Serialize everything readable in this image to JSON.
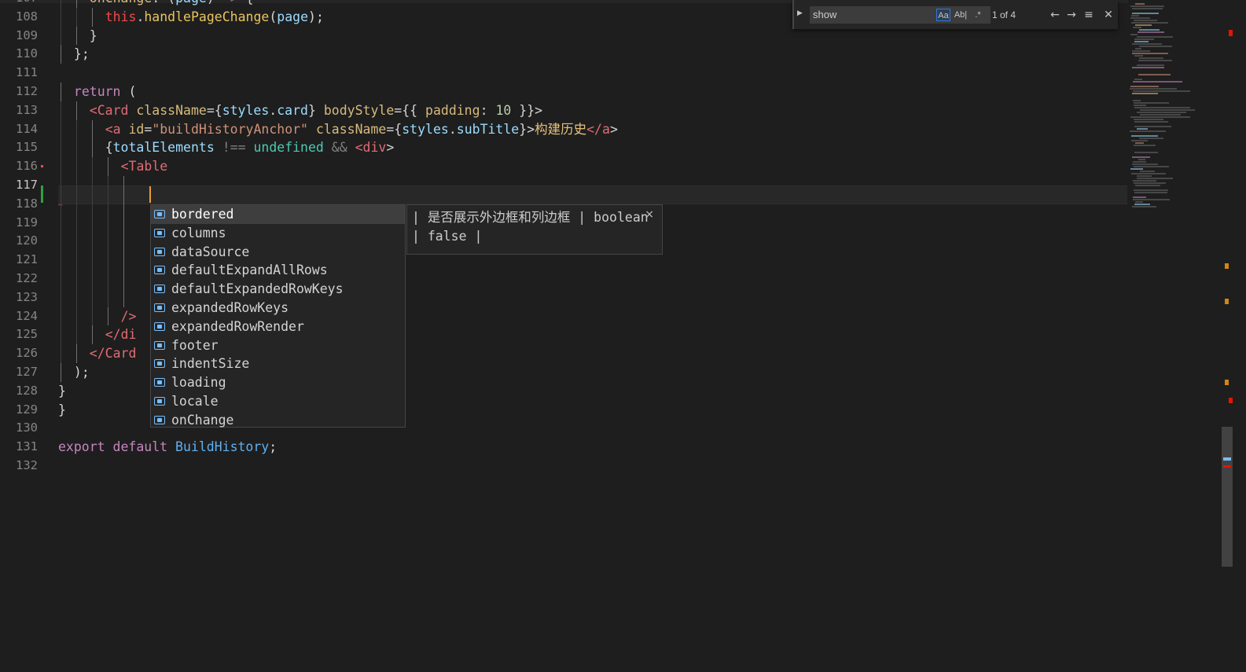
{
  "editor": {
    "line_numbers": [
      "107",
      "108",
      "109",
      "110",
      "111",
      "112",
      "113",
      "114",
      "115",
      "116",
      "117",
      "118",
      "119",
      "120",
      "121",
      "122",
      "123",
      "124",
      "125",
      "126",
      "127",
      "128",
      "129",
      "130",
      "131",
      "132"
    ],
    "active_line": "117",
    "lines": [
      "onChange: (page) => {",
      "this.handlePageChange(page);",
      "}",
      "};",
      "",
      "return (",
      "<Card className={styles.card} bodyStyle={{ padding: 10 }}>",
      "<a id=\"buildHistoryAnchor\" className={styles.subTitle}>构建历史</a>",
      "{totalElements !== undefined && <div>",
      "<Table",
      "",
      "",
      "",
      "",
      "",
      "",
      "",
      "/>",
      "</di",
      "</Card",
      ");",
      "}",
      "}",
      "",
      "export default BuildHistory;",
      ""
    ]
  },
  "find_widget": {
    "query": "show",
    "match_case_label": "Aa",
    "whole_word_label": "Ab|",
    "regex_label": ".*",
    "count": "1 of 4",
    "prev_icon": "arrow-up-icon",
    "next_icon": "arrow-down-icon",
    "selection_icon": "find-in-selection-icon",
    "close_icon": "close-icon"
  },
  "suggest": {
    "items": [
      "bordered",
      "columns",
      "dataSource",
      "defaultExpandAllRows",
      "defaultExpandedRowKeys",
      "expandedRowKeys",
      "expandedRowRender",
      "footer",
      "indentSize",
      "loading",
      "locale",
      "onChange"
    ],
    "selected_index": 0,
    "item_icon": "property-icon"
  },
  "doc_popup": {
    "text": "| 是否展示外边框和列边框 | boolean | false |",
    "close_label": "×"
  }
}
